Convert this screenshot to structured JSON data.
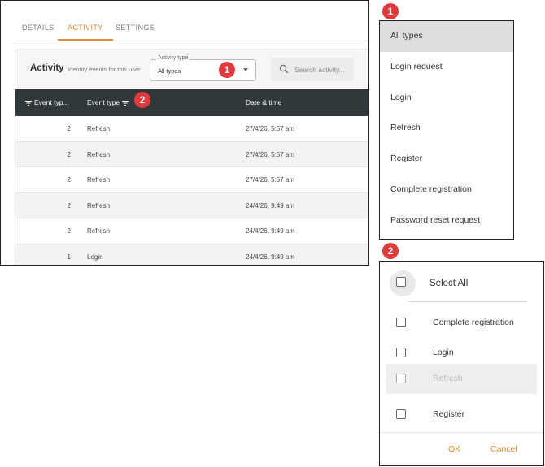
{
  "tabs": [
    "DETAILS",
    "ACTIVITY",
    "SETTINGS"
  ],
  "activity": {
    "title": "Activity",
    "subtitle": "Identity events for this user",
    "filter_legend": "Activity type",
    "filter_value": "All types",
    "search_placeholder": "Search activity..."
  },
  "table": {
    "headers": [
      "Event typ...",
      "Event type",
      "Date & time"
    ],
    "rows": [
      {
        "count": "2",
        "type": "Refresh",
        "date": "27/4/26, 5:57 am"
      },
      {
        "count": "2",
        "type": "Refresh",
        "date": "27/4/26, 5:57 am"
      },
      {
        "count": "2",
        "type": "Refresh",
        "date": "27/4/26, 5:57 am"
      },
      {
        "count": "2",
        "type": "Refresh",
        "date": "24/4/26, 9:49 am"
      },
      {
        "count": "2",
        "type": "Refresh",
        "date": "24/4/26, 9:49 am"
      },
      {
        "count": "1",
        "type": "Login",
        "date": "24/4/26, 9:49 am"
      }
    ]
  },
  "badges": [
    "1",
    "2"
  ],
  "activity_type_menu": {
    "options": [
      "All types",
      "Login request",
      "Login",
      "Refresh",
      "Register",
      "Complete registration",
      "Password reset request"
    ],
    "selected": "All types"
  },
  "event_type_filter": {
    "select_all": "Select All",
    "options": [
      "Complete registration",
      "Login",
      "Refresh",
      "Register"
    ],
    "hovered": "Refresh",
    "ok": "OK",
    "cancel": "Cancel"
  },
  "colors": {
    "accent": "#e38a2f",
    "header": "#31383c",
    "badge": "#e23a3a"
  }
}
